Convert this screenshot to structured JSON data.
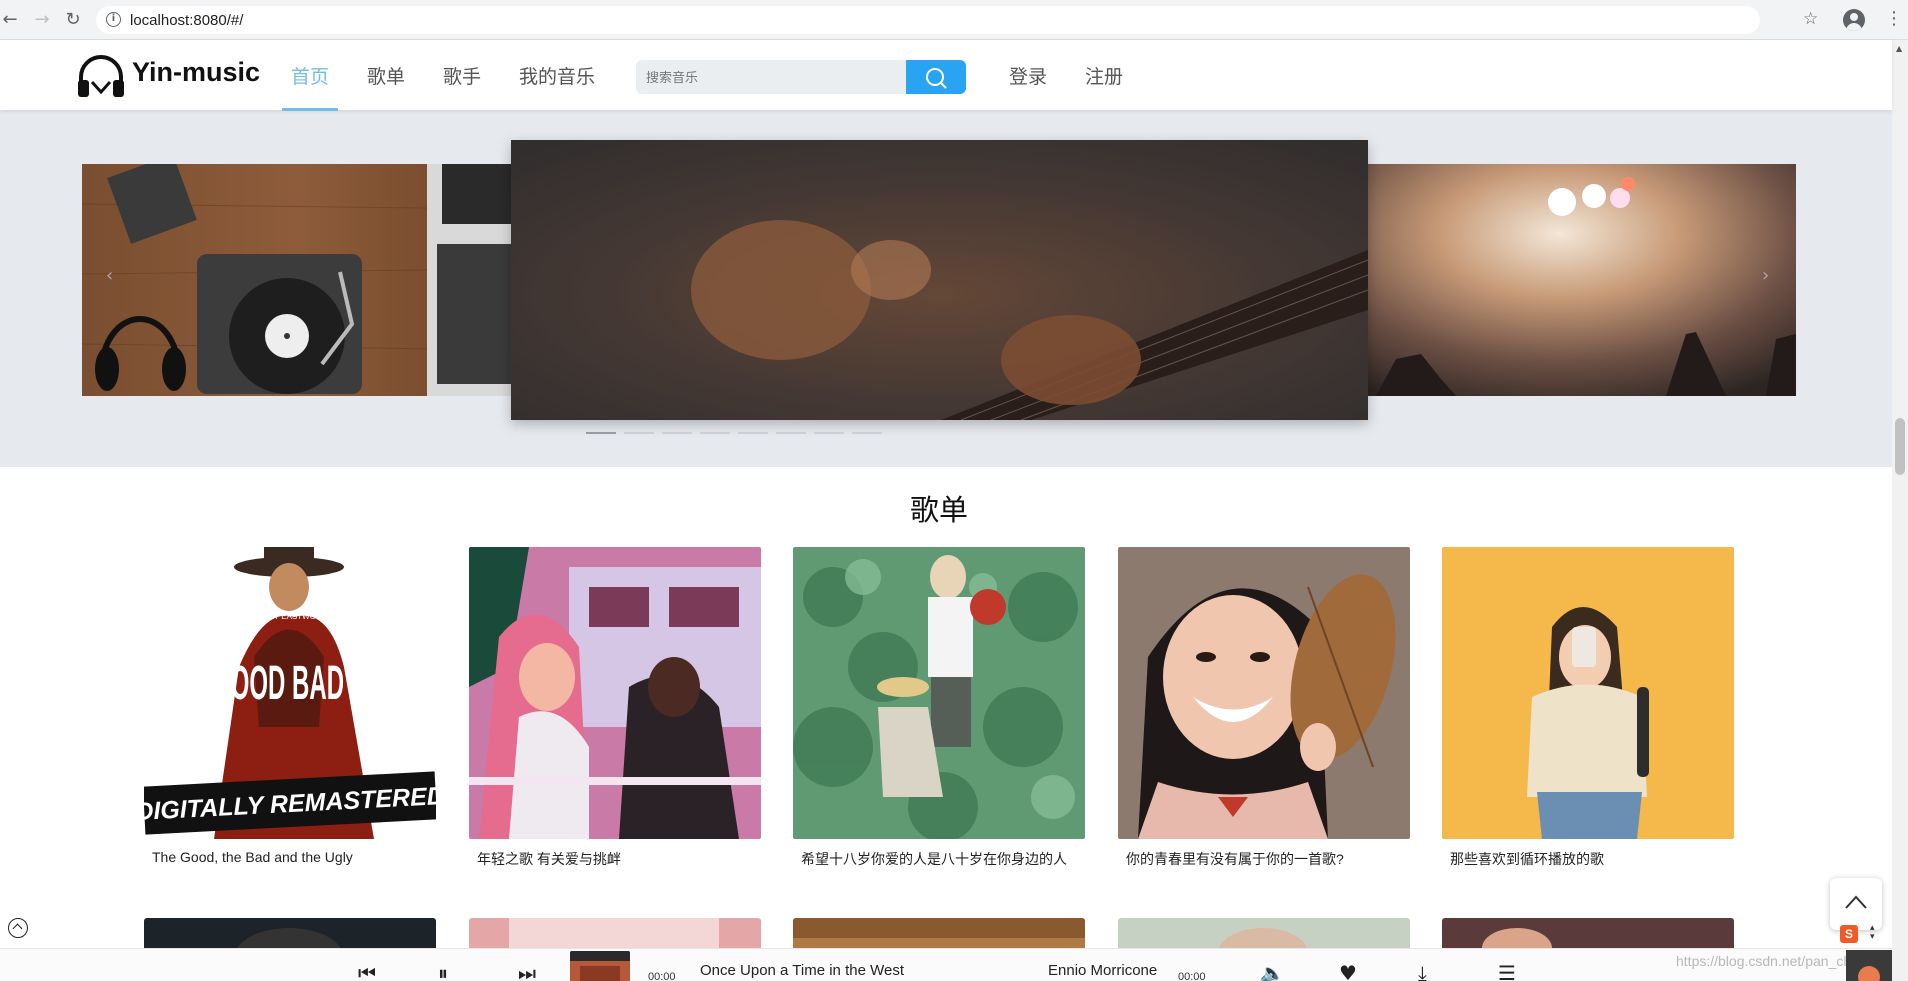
{
  "browser": {
    "url": "localhost:8080/#/",
    "icons": [
      "back-arrow-icon",
      "forward-arrow-icon",
      "reload-icon",
      "info-icon",
      "star-icon",
      "profile-icon",
      "menu-dots-icon"
    ]
  },
  "header": {
    "logo_text": "Yin-music",
    "nav": [
      {
        "label": "首页",
        "active": true
      },
      {
        "label": "歌单",
        "active": false
      },
      {
        "label": "歌手",
        "active": false
      },
      {
        "label": "我的音乐",
        "active": false
      }
    ],
    "search_placeholder": "搜索音乐",
    "login": "登录",
    "register": "注册",
    "accent_color": "#72bcea",
    "search_button_color": "#29a4f2"
  },
  "carousel": {
    "arrow_prev": "‹",
    "arrow_next": "›",
    "dot_count": 8,
    "active_dot": 0
  },
  "playlists": {
    "title": "歌单",
    "items": [
      {
        "title": "The Good, the Bad and the Ugly",
        "cover_text_top": "CLINT EASTWOOD",
        "cover_text_main": "GOOD BAD UGLY",
        "cover_banner": "DIGITALLY REMASTERED"
      },
      {
        "title": "年轻之歌 有关爱与挑衅"
      },
      {
        "title": "希望十八岁你爱的人是八十岁在你身边的人"
      },
      {
        "title": "你的青春里有没有属于你的一首歌?"
      },
      {
        "title": "那些喜欢到循环播放的歌"
      }
    ]
  },
  "player": {
    "controls": [
      "prev-icon",
      "pause-icon",
      "next-icon"
    ],
    "current_time": "00:00",
    "song": "Once Upon a Time in the West",
    "artist": "Ennio Morricone",
    "duration": "00:00",
    "right_icons": [
      "volume-icon",
      "heart-icon",
      "download-icon",
      "playlist-icon"
    ]
  },
  "watermark": "https://blog.csdn.net/pan_clouds",
  "csdn_icon_letter": "S"
}
